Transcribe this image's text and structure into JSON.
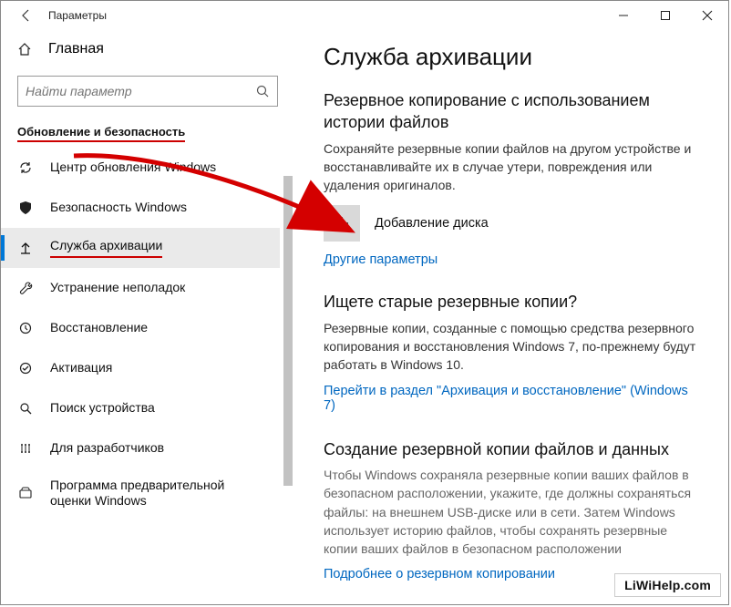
{
  "window": {
    "title": "Параметры"
  },
  "sidebar": {
    "home": "Главная",
    "search_placeholder": "Найти параметр",
    "section": "Обновление и безопасность",
    "items": [
      {
        "label": "Центр обновления Windows"
      },
      {
        "label": "Безопасность Windows"
      },
      {
        "label": "Служба архивации"
      },
      {
        "label": "Устранение неполадок"
      },
      {
        "label": "Восстановление"
      },
      {
        "label": "Активация"
      },
      {
        "label": "Поиск устройства"
      },
      {
        "label": "Для разработчиков"
      },
      {
        "label": "Программа предварительной оценки Windows"
      }
    ]
  },
  "main": {
    "heading": "Служба архивации",
    "s1_title": "Резервное копирование с использованием истории файлов",
    "s1_desc": "Сохраняйте резервные копии файлов на другом устройстве и восстанавливайте их в случае утери, повреждения или удаления оригиналов.",
    "add_drive": "Добавление диска",
    "more_options": "Другие параметры",
    "s2_title": "Ищете старые резервные копии?",
    "s2_desc": "Резервные копии, созданные с помощью средства резервного копирования и восстановления Windows 7, по-прежнему будут работать в Windows 10.",
    "s2_link": "Перейти в раздел \"Архивация и восстановление\" (Windows 7)",
    "s3_title": "Создание резервной копии файлов и данных",
    "s3_desc": "Чтобы Windows сохраняла резервные копии ваших файлов в безопасном расположении, укажите, где должны сохраняться файлы: на внешнем USB-диске или в сети. Затем Windows использует историю файлов, чтобы сохранять резервные копии ваших файлов в безопасном расположении",
    "s3_link": "Подробнее о резервном копировании"
  },
  "watermark": "LiWiHelp.com"
}
